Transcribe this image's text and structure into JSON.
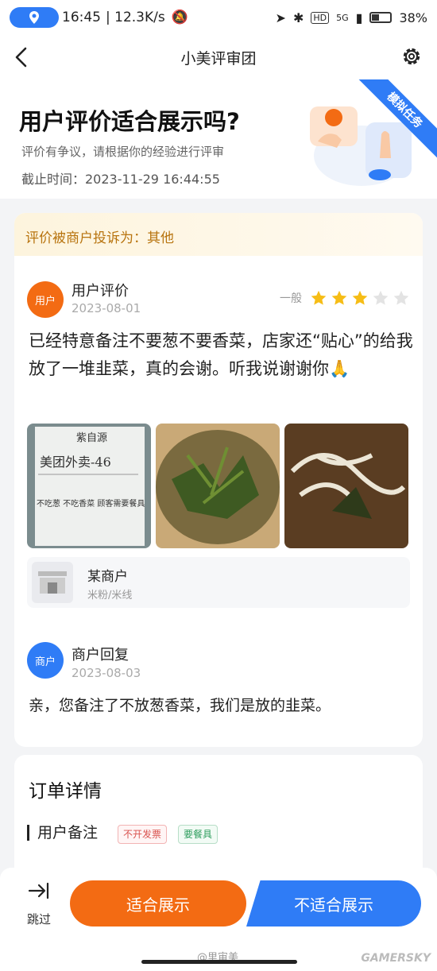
{
  "status_bar": {
    "time": "16:45",
    "net_speed": "| 12.3K/s",
    "signal": "5G",
    "battery": "38%",
    "battery_level": 0.38
  },
  "app_bar": {
    "title": "小美评审团",
    "back_icon": "chevron-left-icon",
    "settings_icon": "gear-icon"
  },
  "hero": {
    "title": "用户评价适合展示吗?",
    "subtitle": "评价有争议，请根据你的经验进行评审",
    "deadline": "截止时间：2023-11-29 16:44:55",
    "ribbon": "模拟任务"
  },
  "complaint": {
    "text": "评价被商户投诉为：其他"
  },
  "user_review": {
    "avatar": "用户",
    "name": "用户评价",
    "date": "2023-08-01",
    "rating_label": "一般",
    "stars": 3,
    "max_stars": 5,
    "text": "已经特意备注不要葱不要香菜，店家还“贴心”的给我放了一堆韭菜，真的会谢。听我说谢谢你🙏",
    "photos": [
      {
        "caption_brand": "紫自源",
        "caption_line": "美团外卖-46",
        "caption_note": "不吃葱 不吃香菜 顾客需要餐具"
      },
      {},
      {}
    ]
  },
  "merchant": {
    "name": "某商户",
    "category": "米粉/米线",
    "icon": "storefront-icon"
  },
  "merchant_reply": {
    "avatar": "商户",
    "name": "商户回复",
    "date": "2023-08-03",
    "text": "亲，您备注了不放葱香菜，我们是放的韭菜。"
  },
  "order": {
    "title": "订单详情",
    "note_label": "用户备注",
    "tags": [
      "不开发票",
      "要餐具"
    ]
  },
  "actions": {
    "skip": "跳过",
    "fit": "适合展示",
    "unfit": "不适合展示"
  },
  "watermarks": {
    "weibo": "@里审美",
    "site": "GAMERSKY"
  },
  "colors": {
    "primary_blue": "#2f7cf6",
    "primary_orange": "#f36b13",
    "star_gold": "#f6bd16",
    "complaint_text": "#b8740f"
  }
}
